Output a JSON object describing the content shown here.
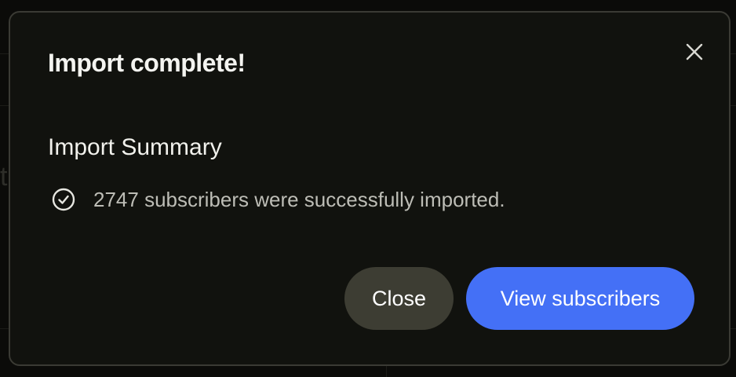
{
  "dialog": {
    "title": "Import complete!",
    "subtitle": "Import Summary",
    "summary_message": "2747 subscribers were successfully imported.",
    "close_icon": "close-icon",
    "status_icon": "check-circle-icon"
  },
  "actions": {
    "close_label": "Close",
    "primary_label": "View subscribers"
  },
  "colors": {
    "primary": "#4470f6",
    "secondary_button": "#3d3d33",
    "modal_background": "#11120e"
  }
}
